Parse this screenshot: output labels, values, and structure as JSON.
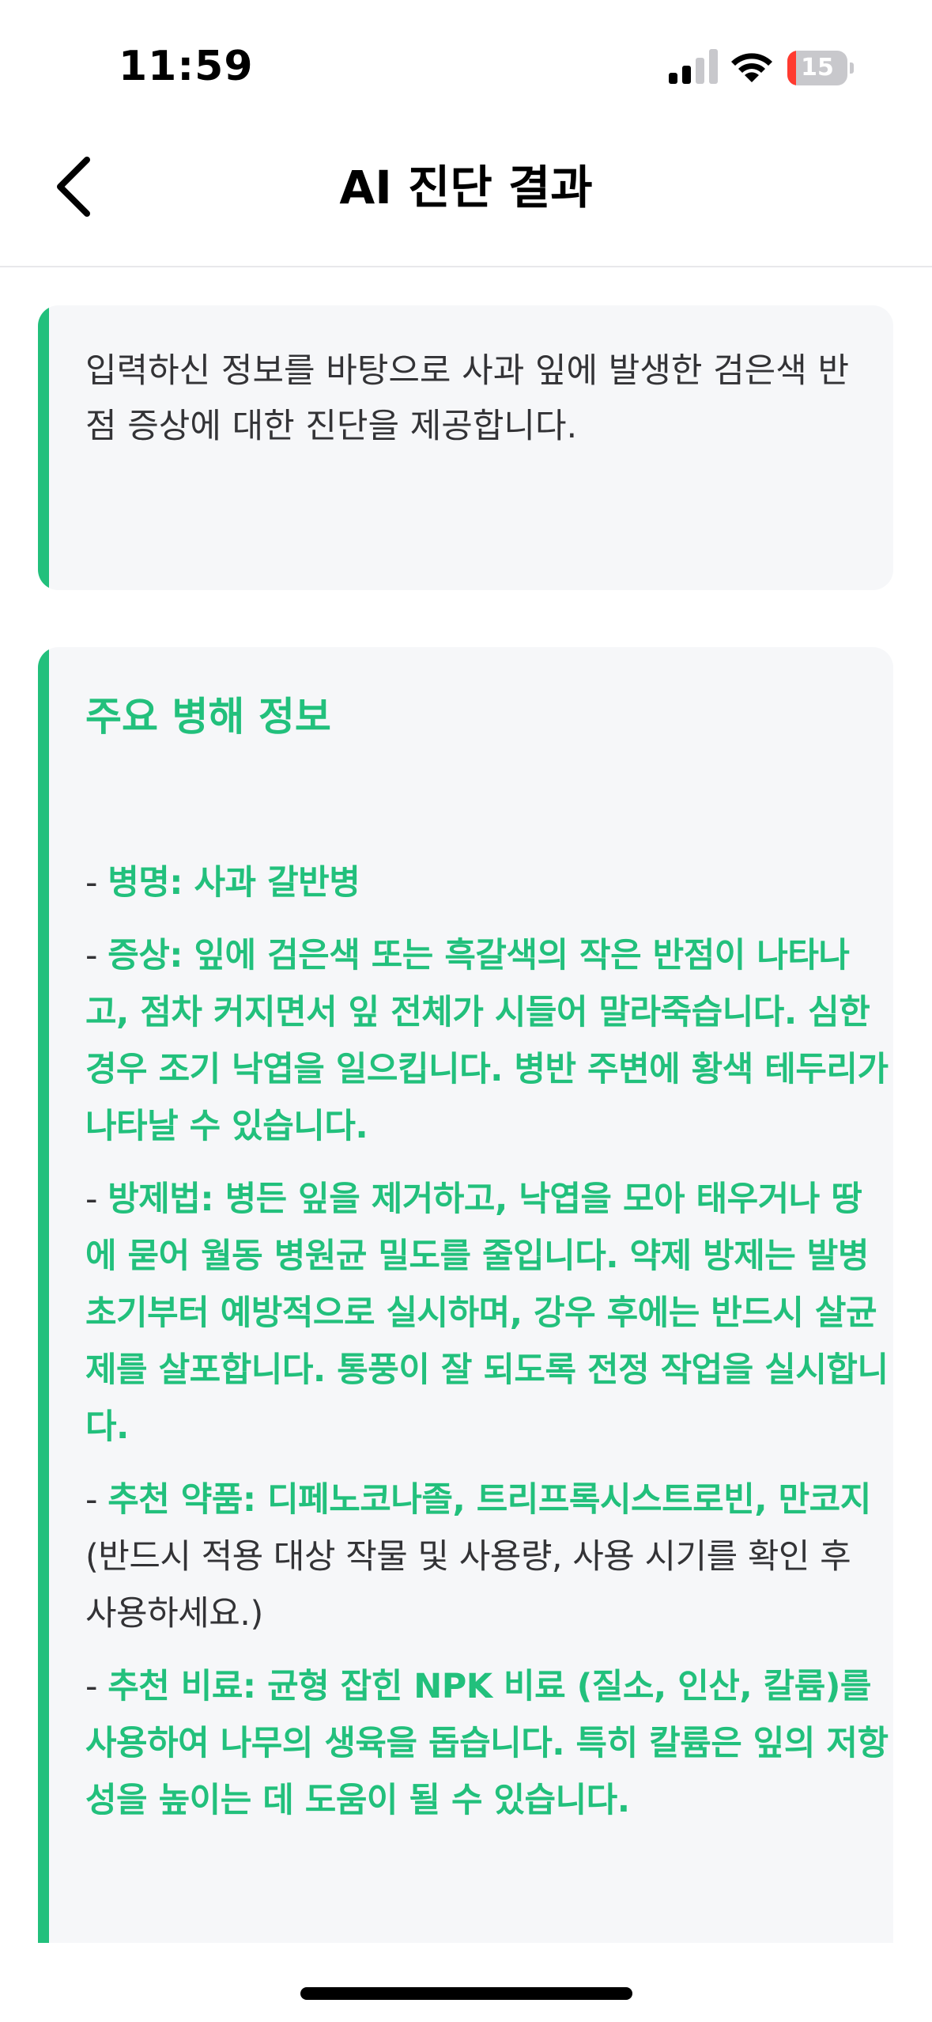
{
  "status_bar": {
    "time": "11:59",
    "battery_level": "15",
    "battery_fraction": 0.15,
    "icons": [
      "signal-icon",
      "wifi-icon",
      "battery-icon"
    ]
  },
  "nav": {
    "title": "AI 진단 결과",
    "back_icon": "chevron-left-icon"
  },
  "intro": {
    "text": "입력하신 정보를 바탕으로 사과 잎에 발생한 검은색 반점 증상에 대한 진단을 제공합니다."
  },
  "info": {
    "heading": "주요 병해 정보",
    "dash": "- ",
    "items": [
      {
        "label": "병명:",
        "content": "사과 갈반병",
        "note": ""
      },
      {
        "label": "증상:",
        "content": "잎에 검은색 또는 흑갈색의 작은 반점이 나타나고, 점차 커지면서 잎 전체가 시들어 말라죽습니다. 심한 경우 조기 낙엽을 일으킵니다. 병반 주변에 황색 테두리가 나타날 수 있습니다.",
        "note": ""
      },
      {
        "label": "방제법:",
        "content": "병든 잎을 제거하고, 낙엽을 모아 태우거나 땅에 묻어 월동 병원균 밀도를 줄입니다. 약제 방제는 발병 초기부터 예방적으로 실시하며, 강우 후에는 반드시 살균제를 살포합니다. 통풍이 잘 되도록 전정 작업을 실시합니다.",
        "note": ""
      },
      {
        "label": "추천 약품:",
        "content": "디페노코나졸, 트리프록시스트로빈, 만코지",
        "note": "(반드시 적용 대상 작물 및 사용량, 사용 시기를 확인 후 사용하세요.)"
      },
      {
        "label": "추천 비료:",
        "content": "균형 잡힌 NPK 비료 (질소, 인산, 칼륨)를 사용하여 나무의 생육을 돕습니다. 특히 칼륨은 잎의 저항성을 높이는 데 도움이 될 수 있습니다.",
        "note": ""
      }
    ]
  },
  "colors": {
    "accent": "#22c07c",
    "card_bg": "#f6f7f9",
    "text": "#333336",
    "battery_low": "#ff3b30"
  }
}
